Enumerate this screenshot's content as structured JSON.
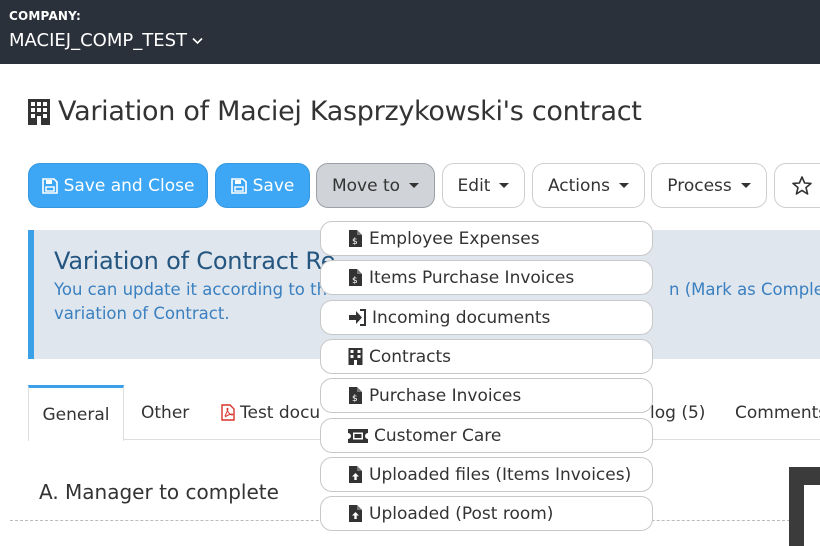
{
  "header": {
    "company_label": "COMPANY:",
    "company_name": "MACIEJ_COMP_TEST"
  },
  "page": {
    "title": "Variation of Maciej Kasprzykowski's contract"
  },
  "toolbar": {
    "save_close_label": "Save and Close",
    "save_label": "Save",
    "move_to_label": "Move to",
    "edit_label": "Edit",
    "actions_label": "Actions",
    "process_label": "Process"
  },
  "move_to_menu": {
    "items": [
      {
        "label": "Employee Expenses",
        "icon": "file-invoice-dollar-icon"
      },
      {
        "label": "Items Purchase Invoices",
        "icon": "file-invoice-dollar-icon"
      },
      {
        "label": "Incoming documents",
        "icon": "sign-in-icon"
      },
      {
        "label": "Contracts",
        "icon": "building-icon"
      },
      {
        "label": "Purchase Invoices",
        "icon": "file-invoice-dollar-icon"
      },
      {
        "label": "Customer Care",
        "icon": "ticket-icon"
      },
      {
        "label": "Uploaded files (Items Invoices)",
        "icon": "file-upload-icon"
      },
      {
        "label": "Uploaded (Post room)",
        "icon": "file-upload-icon"
      }
    ]
  },
  "info_panel": {
    "title": "Variation of Contract Re",
    "line1_left": "You can update it according to th",
    "line1_right": "n (Mark as Complete",
    "line2": "variation of Contract."
  },
  "tabs": [
    {
      "label": "General"
    },
    {
      "label": "Other"
    },
    {
      "label": "Test docu"
    },
    {
      "label": "log (5)"
    },
    {
      "label": "Comments"
    }
  ],
  "section": {
    "title": "A. Manager to complete"
  },
  "colors": {
    "topbar": "#2b313a",
    "primary": "#3da7f5",
    "panel_bg": "#e0e6ee",
    "panel_border": "#3aa0e8",
    "panel_title": "#245680",
    "panel_text": "#3a80c0"
  }
}
